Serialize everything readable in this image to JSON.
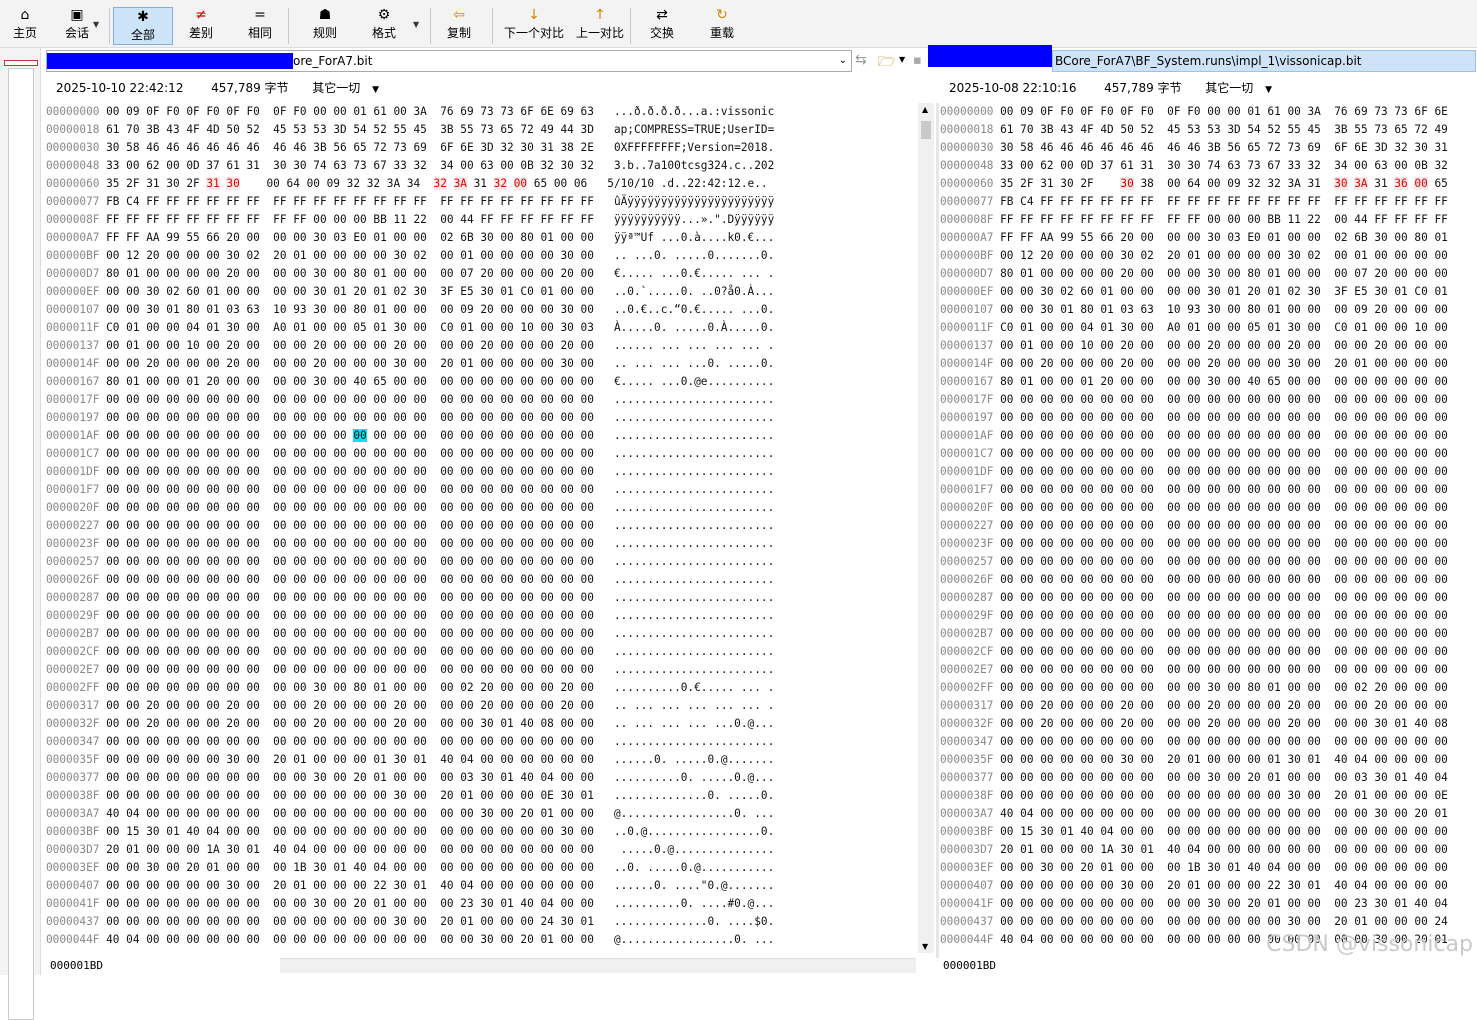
{
  "toolbar": {
    "buttons": [
      {
        "label": "主页",
        "icon": "house-icon",
        "glyph": "⌂"
      },
      {
        "label": "会话",
        "icon": "briefcase-icon",
        "glyph": "▣"
      },
      {
        "label": "全部",
        "icon": "asterisk-icon",
        "glyph": "✱"
      },
      {
        "label": "差别",
        "icon": "not-equal-icon",
        "glyph": "≠"
      },
      {
        "label": "相同",
        "icon": "equal-icon",
        "glyph": "="
      },
      {
        "label": "规则",
        "icon": "person-icon",
        "glyph": "☗"
      },
      {
        "label": "格式",
        "icon": "format-icon",
        "glyph": "⚙"
      },
      {
        "label": "复制",
        "icon": "arrow-left-icon",
        "glyph": "⇦"
      },
      {
        "label": "下一个对比",
        "icon": "arrow-down-icon",
        "glyph": "↓"
      },
      {
        "label": "上一对比",
        "icon": "arrow-up-icon",
        "glyph": "↑"
      },
      {
        "label": "交换",
        "icon": "swap-icon",
        "glyph": "⇄"
      },
      {
        "label": "重载",
        "icon": "reload-icon",
        "glyph": "↻"
      }
    ]
  },
  "colors": {
    "diff": "#e00000",
    "selection": "#00e6ef",
    "redaction": "#0000ff"
  },
  "left": {
    "path": "ore_ForA7.bit",
    "date": "2025-10-10 22:42:12",
    "size": "457,789 字节",
    "encoding": "其它一切",
    "status": "000001BD"
  },
  "right": {
    "path": "BCore_ForA7\\BF_System.runs\\impl_1\\vissonicap.bit",
    "date": "2025-10-08 22:10:16",
    "size": "457,789 字节",
    "encoding": "其它一切",
    "status": "000001BD"
  },
  "watermark": "CSDN @vissonicap",
  "rows": [
    {
      "off": "00000000",
      "l": "00 09 0F F0 0F F0 0F F0  0F F0 00 00 01 61 00 3A  76 69 73 73 6F 6E 69 63",
      "a": "...ð.ð.ð.ð...a.:vissonic",
      "r": "00 09 0F F0 0F F0 0F F0  0F F0 00 00 01 61 00 3A  76 69 73 73 6F 6E"
    },
    {
      "off": "00000018",
      "l": "61 70 3B 43 4F 4D 50 52  45 53 53 3D 54 52 55 45  3B 55 73 65 72 49 44 3D",
      "a": "ap;COMPRESS=TRUE;UserID=",
      "r": "61 70 3B 43 4F 4D 50 52  45 53 53 3D 54 52 55 45  3B 55 73 65 72 49"
    },
    {
      "off": "00000030",
      "l": "30 58 46 46 46 46 46 46  46 46 3B 56 65 72 73 69  6F 6E 3D 32 30 31 38 2E",
      "a": "0XFFFFFFFF;Version=2018.",
      "r": "30 58 46 46 46 46 46 46  46 46 3B 56 65 72 73 69  6F 6E 3D 32 30 31"
    },
    {
      "off": "00000048",
      "l": "33 00 62 00 0D 37 61 31  30 30 74 63 73 67 33 32  34 00 63 00 0B 32 30 32",
      "a": "3.b..7a100tcsg324.c..202",
      "r": "33 00 62 00 0D 37 61 31  30 30 74 63 73 67 33 32  34 00 63 00 0B 32"
    },
    {
      "off": "00000060",
      "l": "35 2F 31 30 2F 31 30    00 64 00 09 32 32 3A 34  32 3A 31 32 00 65 00 06",
      "a": "5/10/10 .d..22:42:12.e..",
      "r": "35 2F 31 30 2F    30 38  00 64 00 09 32 32 3A 31  30 3A 31 36 00 65"
    },
    {
      "off": "00000077",
      "l": "FB C4 FF FF FF FF FF FF  FF FF FF FF FF FF FF FF  FF FF FF FF FF FF FF FF",
      "a": "ûÄÿÿÿÿÿÿÿÿÿÿÿÿÿÿÿÿÿÿÿÿÿÿ",
      "r": "FB C4 FF FF FF FF FF FF  FF FF FF FF FF FF FF FF  FF FF FF FF FF FF"
    },
    {
      "off": "0000008F",
      "l": "FF FF FF FF FF FF FF FF  FF FF 00 00 00 BB 11 22  00 44 FF FF FF FF FF FF",
      "a": "ÿÿÿÿÿÿÿÿÿÿ...».\".Dÿÿÿÿÿÿ",
      "r": "FF FF FF FF FF FF FF FF  FF FF 00 00 00 BB 11 22  00 44 FF FF FF FF"
    },
    {
      "off": "000000A7",
      "l": "FF FF AA 99 55 66 20 00  00 00 30 03 E0 01 00 00  02 6B 30 00 80 01 00 00",
      "a": "ÿÿª™Uf ...0.à....k0.€...",
      "r": "FF FF AA 99 55 66 20 00  00 00 30 03 E0 01 00 00  02 6B 30 00 80 01"
    },
    {
      "off": "000000BF",
      "l": "00 12 20 00 00 00 30 02  20 01 00 00 00 00 30 02  00 01 00 00 00 00 30 00",
      "a": ".. ...0. .....0.......0.",
      "r": "00 12 20 00 00 00 30 02  20 01 00 00 00 00 30 02  00 01 00 00 00 00"
    },
    {
      "off": "000000D7",
      "l": "80 01 00 00 00 00 20 00  00 00 30 00 80 01 00 00  00 07 20 00 00 00 20 00",
      "a": "€..... ...0.€..... ... .",
      "r": "80 01 00 00 00 00 20 00  00 00 30 00 80 01 00 00  00 07 20 00 00 00"
    },
    {
      "off": "000000EF",
      "l": "00 00 30 02 60 01 00 00  00 00 30 01 20 01 02 30  3F E5 30 01 C0 01 00 00",
      "a": "..0.`.....0. ..0?å0.À...",
      "r": "00 00 30 02 60 01 00 00  00 00 30 01 20 01 02 30  3F E5 30 01 C0 01"
    },
    {
      "off": "00000107",
      "l": "00 00 30 01 80 01 03 63  10 93 30 00 80 01 00 00  00 09 20 00 00 00 30 00",
      "a": "..0.€..c.“0.€..... ...0.",
      "r": "00 00 30 01 80 01 03 63  10 93 30 00 80 01 00 00  00 09 20 00 00 00"
    },
    {
      "off": "0000011F",
      "l": "C0 01 00 00 04 01 30 00  A0 01 00 00 05 01 30 00  C0 01 00 00 10 00 30 03",
      "a": "À.....0. .....0.À.....0.",
      "r": "C0 01 00 00 04 01 30 00  A0 01 00 00 05 01 30 00  C0 01 00 00 10 00"
    },
    {
      "off": "00000137",
      "l": "00 01 00 00 10 00 20 00  00 00 20 00 00 00 20 00  00 00 20 00 00 00 20 00",
      "a": "...... ... ... ... ... .",
      "r": "00 01 00 00 10 00 20 00  00 00 20 00 00 00 20 00  00 00 20 00 00 00"
    },
    {
      "off": "0000014F",
      "l": "00 00 20 00 00 00 20 00  00 00 20 00 00 00 30 00  20 01 00 00 00 00 30 00",
      "a": ".. ... ... ...0. .....0.",
      "r": "00 00 20 00 00 00 20 00  00 00 20 00 00 00 30 00  20 01 00 00 00 00"
    },
    {
      "off": "00000167",
      "l": "80 01 00 00 01 20 00 00  00 00 30 00 40 65 00 00  00 00 00 00 00 00 00 00",
      "a": "€..... ...0.@e..........",
      "r": "80 01 00 00 01 20 00 00  00 00 30 00 40 65 00 00  00 00 00 00 00 00"
    },
    {
      "off": "0000017F",
      "l": "00 00 00 00 00 00 00 00  00 00 00 00 00 00 00 00  00 00 00 00 00 00 00 00",
      "a": "........................",
      "r": "00 00 00 00 00 00 00 00  00 00 00 00 00 00 00 00  00 00 00 00 00 00"
    },
    {
      "off": "00000197",
      "l": "00 00 00 00 00 00 00 00  00 00 00 00 00 00 00 00  00 00 00 00 00 00 00 00",
      "a": "........................",
      "r": "00 00 00 00 00 00 00 00  00 00 00 00 00 00 00 00  00 00 00 00 00 00"
    },
    {
      "off": "000001AF",
      "l": "00 00 00 00 00 00 00 00  00 00 00 00 00 00 00 00  00 00 00 00 00 00 00 00",
      "a": "........................",
      "r": "00 00 00 00 00 00 00 00  00 00 00 00 00 00 00 00  00 00 00 00 00 00"
    },
    {
      "off": "000001C7",
      "l": "00 00 00 00 00 00 00 00  00 00 00 00 00 00 00 00  00 00 00 00 00 00 00 00",
      "a": "........................",
      "r": "00 00 00 00 00 00 00 00  00 00 00 00 00 00 00 00  00 00 00 00 00 00"
    },
    {
      "off": "000001DF",
      "l": "00 00 00 00 00 00 00 00  00 00 00 00 00 00 00 00  00 00 00 00 00 00 00 00",
      "a": "........................",
      "r": "00 00 00 00 00 00 00 00  00 00 00 00 00 00 00 00  00 00 00 00 00 00"
    },
    {
      "off": "000001F7",
      "l": "00 00 00 00 00 00 00 00  00 00 00 00 00 00 00 00  00 00 00 00 00 00 00 00",
      "a": "........................",
      "r": "00 00 00 00 00 00 00 00  00 00 00 00 00 00 00 00  00 00 00 00 00 00"
    },
    {
      "off": "0000020F",
      "l": "00 00 00 00 00 00 00 00  00 00 00 00 00 00 00 00  00 00 00 00 00 00 00 00",
      "a": "........................",
      "r": "00 00 00 00 00 00 00 00  00 00 00 00 00 00 00 00  00 00 00 00 00 00"
    },
    {
      "off": "00000227",
      "l": "00 00 00 00 00 00 00 00  00 00 00 00 00 00 00 00  00 00 00 00 00 00 00 00",
      "a": "........................",
      "r": "00 00 00 00 00 00 00 00  00 00 00 00 00 00 00 00  00 00 00 00 00 00"
    },
    {
      "off": "0000023F",
      "l": "00 00 00 00 00 00 00 00  00 00 00 00 00 00 00 00  00 00 00 00 00 00 00 00",
      "a": "........................",
      "r": "00 00 00 00 00 00 00 00  00 00 00 00 00 00 00 00  00 00 00 00 00 00"
    },
    {
      "off": "00000257",
      "l": "00 00 00 00 00 00 00 00  00 00 00 00 00 00 00 00  00 00 00 00 00 00 00 00",
      "a": "........................",
      "r": "00 00 00 00 00 00 00 00  00 00 00 00 00 00 00 00  00 00 00 00 00 00"
    },
    {
      "off": "0000026F",
      "l": "00 00 00 00 00 00 00 00  00 00 00 00 00 00 00 00  00 00 00 00 00 00 00 00",
      "a": "........................",
      "r": "00 00 00 00 00 00 00 00  00 00 00 00 00 00 00 00  00 00 00 00 00 00"
    },
    {
      "off": "00000287",
      "l": "00 00 00 00 00 00 00 00  00 00 00 00 00 00 00 00  00 00 00 00 00 00 00 00",
      "a": "........................",
      "r": "00 00 00 00 00 00 00 00  00 00 00 00 00 00 00 00  00 00 00 00 00 00"
    },
    {
      "off": "0000029F",
      "l": "00 00 00 00 00 00 00 00  00 00 00 00 00 00 00 00  00 00 00 00 00 00 00 00",
      "a": "........................",
      "r": "00 00 00 00 00 00 00 00  00 00 00 00 00 00 00 00  00 00 00 00 00 00"
    },
    {
      "off": "000002B7",
      "l": "00 00 00 00 00 00 00 00  00 00 00 00 00 00 00 00  00 00 00 00 00 00 00 00",
      "a": "........................",
      "r": "00 00 00 00 00 00 00 00  00 00 00 00 00 00 00 00  00 00 00 00 00 00"
    },
    {
      "off": "000002CF",
      "l": "00 00 00 00 00 00 00 00  00 00 00 00 00 00 00 00  00 00 00 00 00 00 00 00",
      "a": "........................",
      "r": "00 00 00 00 00 00 00 00  00 00 00 00 00 00 00 00  00 00 00 00 00 00"
    },
    {
      "off": "000002E7",
      "l": "00 00 00 00 00 00 00 00  00 00 00 00 00 00 00 00  00 00 00 00 00 00 00 00",
      "a": "........................",
      "r": "00 00 00 00 00 00 00 00  00 00 00 00 00 00 00 00  00 00 00 00 00 00"
    },
    {
      "off": "000002FF",
      "l": "00 00 00 00 00 00 00 00  00 00 30 00 80 01 00 00  00 02 20 00 00 00 20 00",
      "a": "..........0.€..... ... .",
      "r": "00 00 00 00 00 00 00 00  00 00 30 00 80 01 00 00  00 02 20 00 00 00"
    },
    {
      "off": "00000317",
      "l": "00 00 20 00 00 00 20 00  00 00 20 00 00 00 20 00  00 00 20 00 00 00 20 00",
      "a": ".. ... ... ... ... ... .",
      "r": "00 00 20 00 00 00 20 00  00 00 20 00 00 00 20 00  00 00 20 00 00 00"
    },
    {
      "off": "0000032F",
      "l": "00 00 20 00 00 00 20 00  00 00 20 00 00 00 20 00  00 00 30 01 40 08 00 00",
      "a": ".. ... ... ... ...0.@...",
      "r": "00 00 20 00 00 00 20 00  00 00 20 00 00 00 20 00  00 00 30 01 40 08"
    },
    {
      "off": "00000347",
      "l": "00 00 00 00 00 00 00 00  00 00 00 00 00 00 00 00  00 00 00 00 00 00 00 00",
      "a": "........................",
      "r": "00 00 00 00 00 00 00 00  00 00 00 00 00 00 00 00  00 00 00 00 00 00"
    },
    {
      "off": "0000035F",
      "l": "00 00 00 00 00 00 30 00  20 01 00 00 00 01 30 01  40 04 00 00 00 00 00 00",
      "a": "......0. .....0.@.......",
      "r": "00 00 00 00 00 00 30 00  20 01 00 00 00 01 30 01  40 04 00 00 00 00"
    },
    {
      "off": "00000377",
      "l": "00 00 00 00 00 00 00 00  00 00 30 00 20 01 00 00  00 03 30 01 40 04 00 00",
      "a": "..........0. .....0.@...",
      "r": "00 00 00 00 00 00 00 00  00 00 30 00 20 01 00 00  00 03 30 01 40 04"
    },
    {
      "off": "0000038F",
      "l": "00 00 00 00 00 00 00 00  00 00 00 00 00 00 30 00  20 01 00 00 00 0E 30 01",
      "a": "..............0. .....0.",
      "r": "00 00 00 00 00 00 00 00  00 00 00 00 00 00 30 00  20 01 00 00 00 0E"
    },
    {
      "off": "000003A7",
      "l": "40 04 00 00 00 00 00 00  00 00 00 00 00 00 00 00  00 00 30 00 20 01 00 00",
      "a": "@.................0. ...",
      "r": "40 04 00 00 00 00 00 00  00 00 00 00 00 00 00 00  00 00 30 00 20 01"
    },
    {
      "off": "000003BF",
      "l": "00 15 30 01 40 04 00 00  00 00 00 00 00 00 00 00  00 00 00 00 00 00 30 00",
      "a": "..0.@.................0.",
      "r": "00 15 30 01 40 04 00 00  00 00 00 00 00 00 00 00  00 00 00 00 00 00"
    },
    {
      "off": "000003D7",
      "l": "20 01 00 00 00 1A 30 01  40 04 00 00 00 00 00 00  00 00 00 00 00 00 00 00",
      " a": "",
      "a": " .....0.@...............",
      "r": "20 01 00 00 00 1A 30 01  40 04 00 00 00 00 00 00  00 00 00 00 00 00"
    },
    {
      "off": "000003EF",
      "l": "00 00 30 00 20 01 00 00  00 1B 30 01 40 04 00 00  00 00 00 00 00 00 00 00",
      "a": "..0. .....0.@...........",
      "r": "00 00 30 00 20 01 00 00  00 1B 30 01 40 04 00 00  00 00 00 00 00 00"
    },
    {
      "off": "00000407",
      "l": "00 00 00 00 00 00 30 00  20 01 00 00 00 22 30 01  40 04 00 00 00 00 00 00",
      "a": "......0. ....\"0.@.......",
      "r": "00 00 00 00 00 00 30 00  20 01 00 00 00 22 30 01  40 04 00 00 00 00"
    },
    {
      "off": "0000041F",
      "l": "00 00 00 00 00 00 00 00  00 00 30 00 20 01 00 00  00 23 30 01 40 04 00 00",
      "a": "..........0. ....#0.@...",
      "r": "00 00 00 00 00 00 00 00  00 00 30 00 20 01 00 00  00 23 30 01 40 04"
    },
    {
      "off": "00000437",
      "l": "00 00 00 00 00 00 00 00  00 00 00 00 00 00 30 00  20 01 00 00 00 24 30 01",
      "a": "..............0. ....$0.",
      "r": "00 00 00 00 00 00 00 00  00 00 00 00 00 00 30 00  20 01 00 00 00 24"
    },
    {
      "off": "0000044F",
      "l": "40 04 00 00 00 00 00 00  00 00 00 00 00 00 00 00  00 00 30 00 20 01 00 00",
      "a": "@.................0. ...",
      "r": "40 04 00 00 00 00 00 00  00 00 00 00 00 00 00 00  00 00 30 00 20 01"
    }
  ]
}
